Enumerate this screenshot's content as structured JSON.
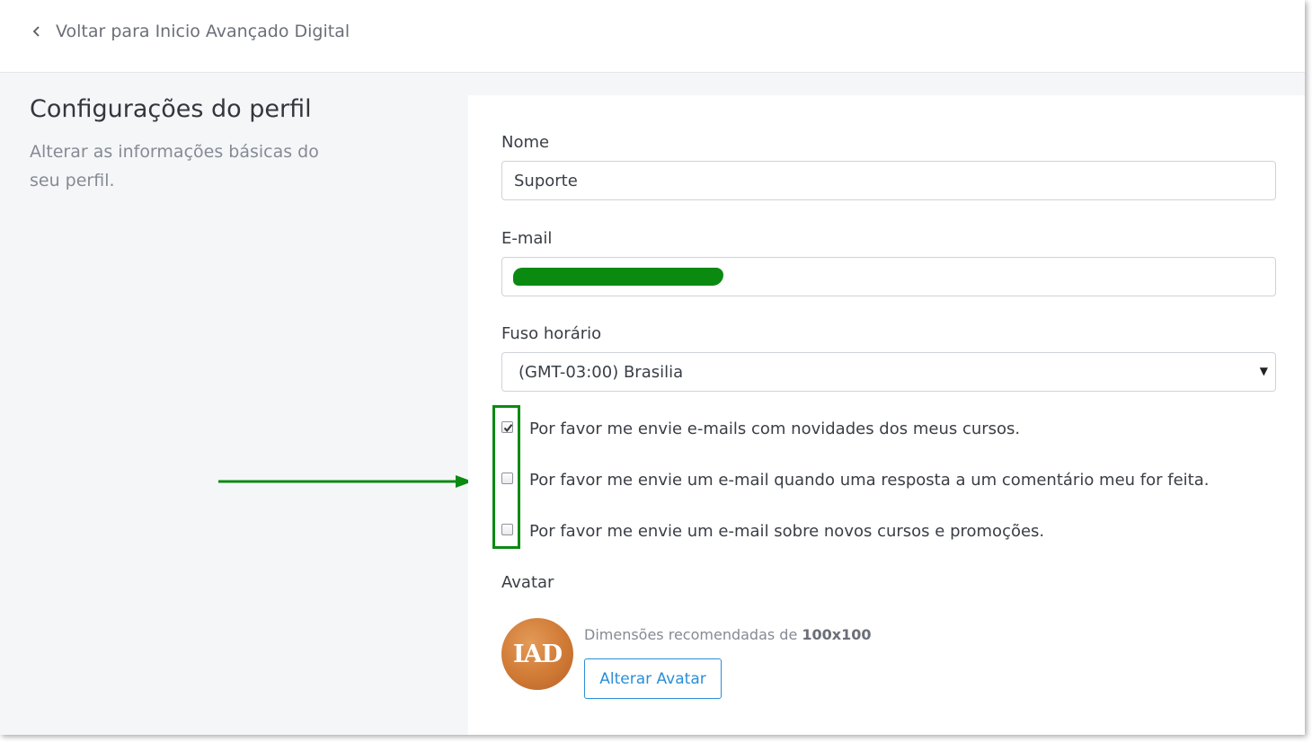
{
  "nav": {
    "back_label": "Voltar para Inicio Avançado Digital"
  },
  "intro": {
    "title": "Configurações do perfil",
    "subtitle": "Alterar as informações básicas do seu perfil."
  },
  "form": {
    "name_label": "Nome",
    "name_value": "Suporte",
    "email_label": "E-mail",
    "timezone_label": "Fuso horário",
    "timezone_value": "(GMT-03:00) Brasilia",
    "checkboxes": [
      {
        "label": "Por favor me envie e-mails com novidades dos meus cursos.",
        "checked": true
      },
      {
        "label": "Por favor me envie um e-mail quando uma resposta a um comentário meu for feita.",
        "checked": false
      },
      {
        "label": "Por favor me envie um e-mail sobre novos cursos e promoções.",
        "checked": false
      }
    ]
  },
  "avatar": {
    "label": "Avatar",
    "logo_text": "IAD",
    "hint_prefix": "Dimensões recomendadas de",
    "hint_size": "100x100",
    "button_label": "Alterar Avatar"
  },
  "colors": {
    "annotation": "#0b8a12",
    "accent": "#2b8fd6",
    "avatar": "#cf7a35"
  },
  "icons": {
    "back": "chevron-left-icon",
    "select": "caret-down-icon",
    "check": "check-icon",
    "annotation": "arrow-right-icon"
  }
}
